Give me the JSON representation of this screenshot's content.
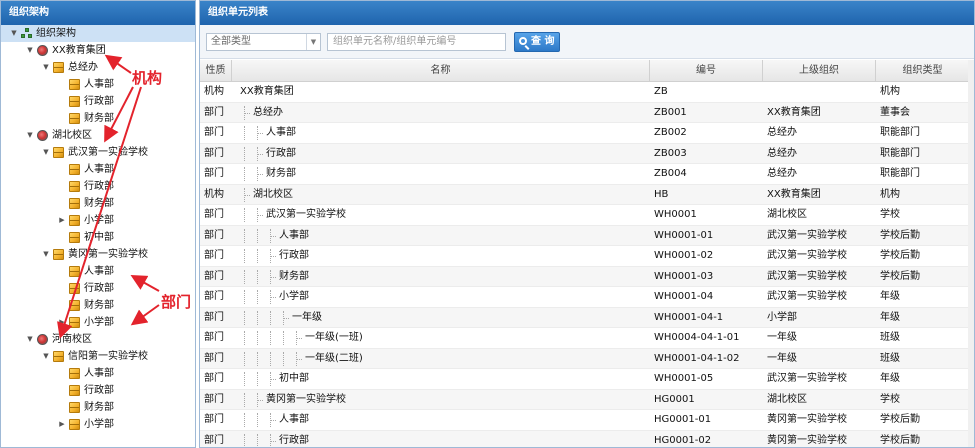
{
  "left_panel": {
    "title": "组织架构",
    "tree": [
      {
        "label": "组织架构",
        "level": 0,
        "icon": "org-tree-icon",
        "toggle": "▼"
      },
      {
        "label": "XX教育集团",
        "level": 1,
        "icon": "organization-icon",
        "toggle": "▼"
      },
      {
        "label": "总经办",
        "level": 2,
        "icon": "department-icon",
        "toggle": "▼"
      },
      {
        "label": "人事部",
        "level": 3,
        "icon": "department-icon",
        "toggle": ""
      },
      {
        "label": "行政部",
        "level": 3,
        "icon": "department-icon",
        "toggle": ""
      },
      {
        "label": "财务部",
        "level": 3,
        "icon": "department-icon",
        "toggle": ""
      },
      {
        "label": "湖北校区",
        "level": 1.6,
        "icon": "organization-icon",
        "toggle": "▼"
      },
      {
        "label": "武汉第一实验学校",
        "level": 2,
        "icon": "department-icon",
        "toggle": "▼"
      },
      {
        "label": "人事部",
        "level": 3,
        "icon": "department-icon",
        "toggle": ""
      },
      {
        "label": "行政部",
        "level": 3,
        "icon": "department-icon",
        "toggle": ""
      },
      {
        "label": "财务部",
        "level": 3,
        "icon": "department-icon",
        "toggle": ""
      },
      {
        "label": "小学部",
        "level": 3,
        "icon": "department-icon",
        "toggle": "▶"
      },
      {
        "label": "初中部",
        "level": 3,
        "icon": "department-icon",
        "toggle": ""
      },
      {
        "label": "黄冈第一实验学校",
        "level": 2,
        "icon": "department-icon",
        "toggle": "▼"
      },
      {
        "label": "人事部",
        "level": 3,
        "icon": "department-icon",
        "toggle": ""
      },
      {
        "label": "行政部",
        "level": 3,
        "icon": "department-icon",
        "toggle": ""
      },
      {
        "label": "财务部",
        "level": 3,
        "icon": "department-icon",
        "toggle": ""
      },
      {
        "label": "小学部",
        "level": 3,
        "icon": "department-icon",
        "toggle": "▶"
      },
      {
        "label": "河南校区",
        "level": 1.6,
        "icon": "organization-icon",
        "toggle": "▼"
      },
      {
        "label": "信阳第一实验学校",
        "level": 2,
        "icon": "department-icon",
        "toggle": "▼"
      },
      {
        "label": "人事部",
        "level": 3,
        "icon": "department-icon",
        "toggle": ""
      },
      {
        "label": "行政部",
        "level": 3,
        "icon": "department-icon",
        "toggle": ""
      },
      {
        "label": "财务部",
        "level": 3,
        "icon": "department-icon",
        "toggle": ""
      },
      {
        "label": "小学部",
        "level": 3,
        "icon": "department-icon",
        "toggle": "▶"
      }
    ],
    "annotations": {
      "org_label": "机构",
      "dept_label": "部门",
      "color": "#e3232c"
    }
  },
  "right_panel": {
    "title": "组织单元列表",
    "toolbar": {
      "type_select_value": "全部类型",
      "search_placeholder": "组织单元名称/组织单元编号",
      "query_button": "查 询"
    },
    "columns": [
      "性质",
      "名称",
      "编号",
      "上级组织",
      "组织类型"
    ],
    "rows": [
      {
        "nature": "机构",
        "name": "XX教育集团",
        "depth": 0,
        "code": "ZB",
        "parent": "",
        "type": "机构"
      },
      {
        "nature": "部门",
        "name": "总经办",
        "depth": 1,
        "code": "ZB001",
        "parent": "XX教育集团",
        "type": "董事会"
      },
      {
        "nature": "部门",
        "name": "人事部",
        "depth": 2,
        "code": "ZB002",
        "parent": "总经办",
        "type": "职能部门"
      },
      {
        "nature": "部门",
        "name": "行政部",
        "depth": 2,
        "code": "ZB003",
        "parent": "总经办",
        "type": "职能部门"
      },
      {
        "nature": "部门",
        "name": "财务部",
        "depth": 2,
        "code": "ZB004",
        "parent": "总经办",
        "type": "职能部门"
      },
      {
        "nature": "机构",
        "name": "湖北校区",
        "depth": 1,
        "code": "HB",
        "parent": "XX教育集团",
        "type": "机构"
      },
      {
        "nature": "部门",
        "name": "武汉第一实验学校",
        "depth": 2,
        "code": "WH0001",
        "parent": "湖北校区",
        "type": "学校"
      },
      {
        "nature": "部门",
        "name": "人事部",
        "depth": 3,
        "code": "WH0001-01",
        "parent": "武汉第一实验学校",
        "type": "学校后勤"
      },
      {
        "nature": "部门",
        "name": "行政部",
        "depth": 3,
        "code": "WH0001-02",
        "parent": "武汉第一实验学校",
        "type": "学校后勤"
      },
      {
        "nature": "部门",
        "name": "财务部",
        "depth": 3,
        "code": "WH0001-03",
        "parent": "武汉第一实验学校",
        "type": "学校后勤"
      },
      {
        "nature": "部门",
        "name": "小学部",
        "depth": 3,
        "code": "WH0001-04",
        "parent": "武汉第一实验学校",
        "type": "年级"
      },
      {
        "nature": "部门",
        "name": "一年级",
        "depth": 4,
        "code": "WH0001-04-1",
        "parent": "小学部",
        "type": "年级"
      },
      {
        "nature": "部门",
        "name": "一年级(一班)",
        "depth": 5,
        "code": "WH0004-04-1-01",
        "parent": "一年级",
        "type": "班级"
      },
      {
        "nature": "部门",
        "name": "一年级(二班)",
        "depth": 5,
        "code": "WH0001-04-1-02",
        "parent": "一年级",
        "type": "班级"
      },
      {
        "nature": "部门",
        "name": "初中部",
        "depth": 3,
        "code": "WH0001-05",
        "parent": "武汉第一实验学校",
        "type": "年级"
      },
      {
        "nature": "部门",
        "name": "黄冈第一实验学校",
        "depth": 2,
        "code": "HG0001",
        "parent": "湖北校区",
        "type": "学校"
      },
      {
        "nature": "部门",
        "name": "人事部",
        "depth": 3,
        "code": "HG0001-01",
        "parent": "黄冈第一实验学校",
        "type": "学校后勤"
      },
      {
        "nature": "部门",
        "name": "行政部",
        "depth": 3,
        "code": "HG0001-02",
        "parent": "黄冈第一实验学校",
        "type": "学校后勤"
      }
    ]
  }
}
